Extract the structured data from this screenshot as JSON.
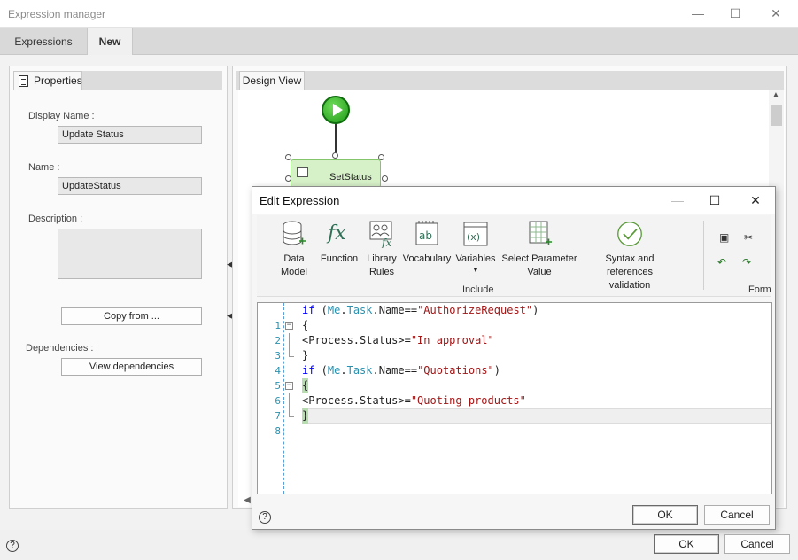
{
  "window": {
    "title": "Expression manager"
  },
  "tabs": [
    {
      "label": "Expressions"
    },
    {
      "label": "New"
    }
  ],
  "properties": {
    "tab_label": "Properties",
    "display_name_label": "Display Name :",
    "display_name_value": "Update Status",
    "name_label": "Name :",
    "name_value": "UpdateStatus",
    "description_label": "Description :",
    "description_value": "",
    "copy_from_label": "Copy from ...",
    "dependencies_label": "Dependencies :",
    "view_dependencies_label": "View dependencies"
  },
  "design_view": {
    "tab_label": "Design View",
    "task_label": "SetStatus"
  },
  "dialog": {
    "title": "Edit Expression",
    "ribbon": {
      "buttons": [
        {
          "line1": "Data",
          "line2": "Model",
          "icon": "database-icon"
        },
        {
          "line1": "Function",
          "line2": "",
          "icon": "function-icon"
        },
        {
          "line1": "Library",
          "line2": "Rules",
          "icon": "library-rules-icon"
        },
        {
          "line1": "Vocabulary",
          "line2": "",
          "icon": "vocabulary-icon"
        },
        {
          "line1": "Variables",
          "line2": "",
          "icon": "variables-icon"
        },
        {
          "line1": "Select Parameter",
          "line2": "Value",
          "icon": "select-parameter-icon"
        },
        {
          "line1": "Syntax and references",
          "line2": "validation",
          "icon": "validation-check-icon"
        }
      ],
      "include_group_label": "Include",
      "format_group_label": "Form"
    },
    "code_lines": [
      {
        "n": "1",
        "text": "if (Me.Task.Name==\"AuthorizeRequest\")"
      },
      {
        "n": "2",
        "text": "{"
      },
      {
        "n": "3",
        "text": "<Process.Status>=\"In approval\""
      },
      {
        "n": "4",
        "text": "}"
      },
      {
        "n": "5",
        "text": "if (Me.Task.Name==\"Quotations\")"
      },
      {
        "n": "6",
        "text": "{"
      },
      {
        "n": "7",
        "text": "<Process.Status>=\"Quoting products\""
      },
      {
        "n": "8",
        "text": "}"
      }
    ],
    "ok_label": "OK",
    "cancel_label": "Cancel"
  },
  "footer": {
    "ok_label": "OK",
    "cancel_label": "Cancel"
  },
  "colors": {
    "keyword": "#0000ff",
    "member": "#2b91af",
    "string": "#a31515",
    "start_node": "#1d9a16",
    "task_fill": "#d6f0c8"
  }
}
